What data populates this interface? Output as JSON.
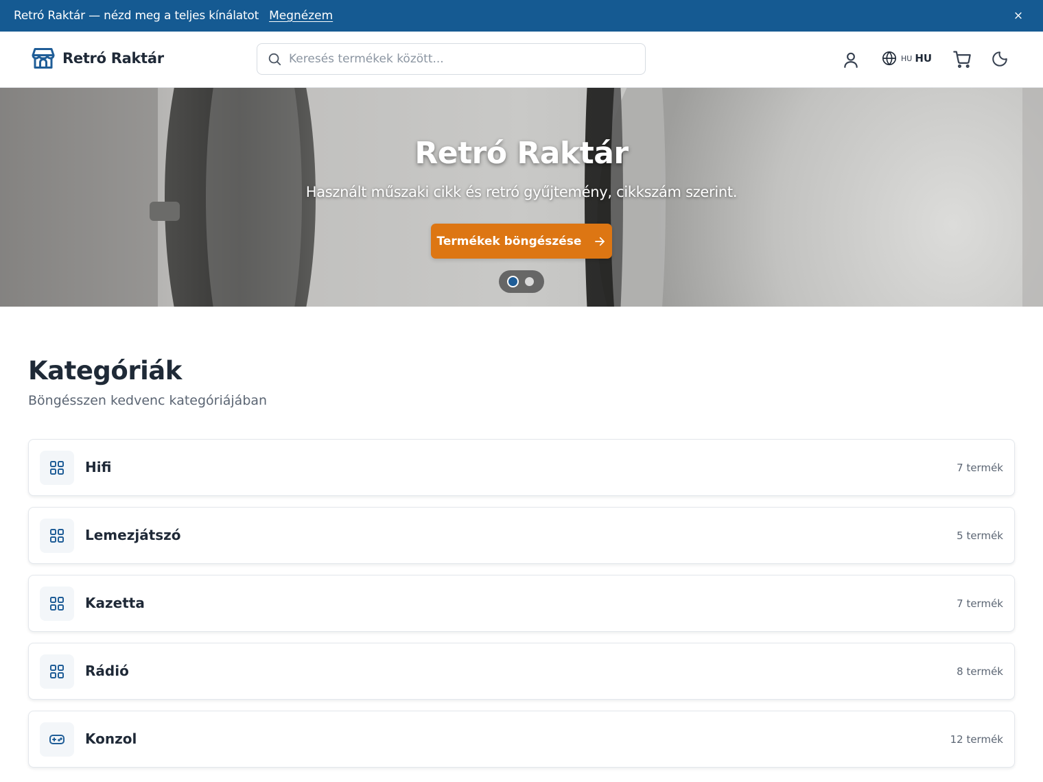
{
  "promo": {
    "text": "Retró Raktár — nézd meg a teljes kínálatot",
    "link": "Megnézem",
    "close_glyph": "×"
  },
  "header": {
    "brand": "Retró Raktár",
    "search_placeholder": "Keresés termékek között...",
    "lang_small": "HU",
    "lang_code": "HU"
  },
  "hero": {
    "title": "Retró Raktár",
    "subtitle": "Használt műszaki cikk és retró gyűjtemény, cikkszám szerint.",
    "cta": "Termékek böngészése",
    "slides": 2,
    "active_slide": 1
  },
  "categories": {
    "title": "Kategóriák",
    "subtitle": "Böngésszen kedvenc kategóriájában",
    "items": [
      {
        "name": "Hifi",
        "count": "7 termék",
        "icon": "grid-icon"
      },
      {
        "name": "Lemezjátszó",
        "count": "5 termék",
        "icon": "grid-icon"
      },
      {
        "name": "Kazetta",
        "count": "7 termék",
        "icon": "grid-icon"
      },
      {
        "name": "Rádió",
        "count": "8 termék",
        "icon": "grid-icon"
      },
      {
        "name": "Konzol",
        "count": "12 termék",
        "icon": "gamepad-icon"
      }
    ]
  },
  "colors": {
    "brand_blue": "#155a92",
    "cta_orange": "#dd7613",
    "icon_blue": "#1f5d97"
  }
}
